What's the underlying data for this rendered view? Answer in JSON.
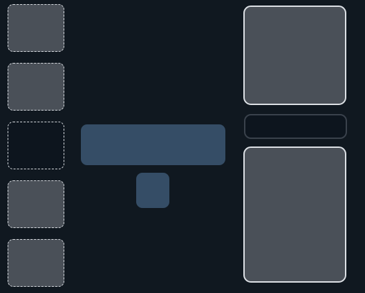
{
  "theme": {
    "background": "#101820",
    "tile": "#4a5058",
    "deep": "#0d151e",
    "accent": "#354d66",
    "slot_border": "#d7dbe0",
    "panel_border": "#dde1e6",
    "pill_border": "#3a424c"
  },
  "left_slots": [
    {
      "state": "filled"
    },
    {
      "state": "filled"
    },
    {
      "state": "empty"
    },
    {
      "state": "filled"
    },
    {
      "state": "filled"
    }
  ]
}
